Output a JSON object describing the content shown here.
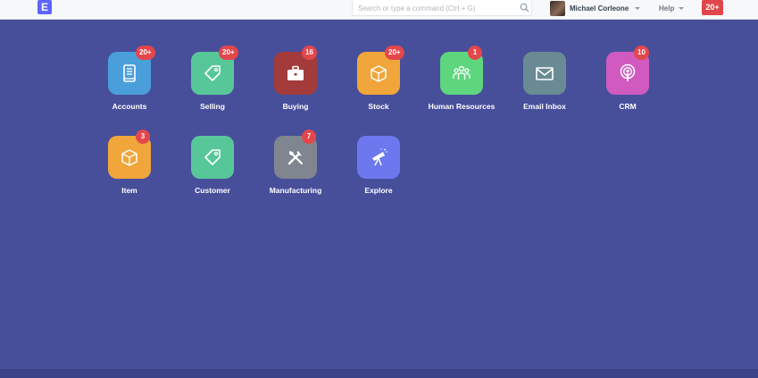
{
  "navbar": {
    "logo_letter": "E",
    "search_placeholder": "Search or type a command (Ctrl + G)",
    "user_name": "Michael Corleone",
    "help_label": "Help",
    "notifications_count": "20+"
  },
  "colors": {
    "background": "#474f9b",
    "badge": "#e3464b"
  },
  "modules": [
    {
      "label": "Accounts",
      "badge": "20+",
      "color": "#4a9fdb",
      "icon": "book-icon"
    },
    {
      "label": "Selling",
      "badge": "20+",
      "color": "#57c79a",
      "icon": "tag-icon"
    },
    {
      "label": "Buying",
      "badge": "16",
      "color": "#a33b3b",
      "icon": "briefcase-icon"
    },
    {
      "label": "Stock",
      "badge": "20+",
      "color": "#f0a63a",
      "icon": "box-icon"
    },
    {
      "label": "Human Resources",
      "badge": "1",
      "color": "#5ed67e",
      "icon": "people-icon"
    },
    {
      "label": "Email Inbox",
      "badge": "",
      "color": "#6a8a94",
      "icon": "envelope-icon"
    },
    {
      "label": "CRM",
      "badge": "10",
      "color": "#d05ac0",
      "icon": "podcast-icon"
    },
    {
      "label": "Item",
      "badge": "3",
      "color": "#f0a63a",
      "icon": "box-icon"
    },
    {
      "label": "Customer",
      "badge": "",
      "color": "#57c79a",
      "icon": "tag-icon"
    },
    {
      "label": "Manufacturing",
      "badge": "7",
      "color": "#7f8690",
      "icon": "tools-icon"
    },
    {
      "label": "Explore",
      "badge": "",
      "color": "#6e78ee",
      "icon": "telescope-icon"
    }
  ]
}
